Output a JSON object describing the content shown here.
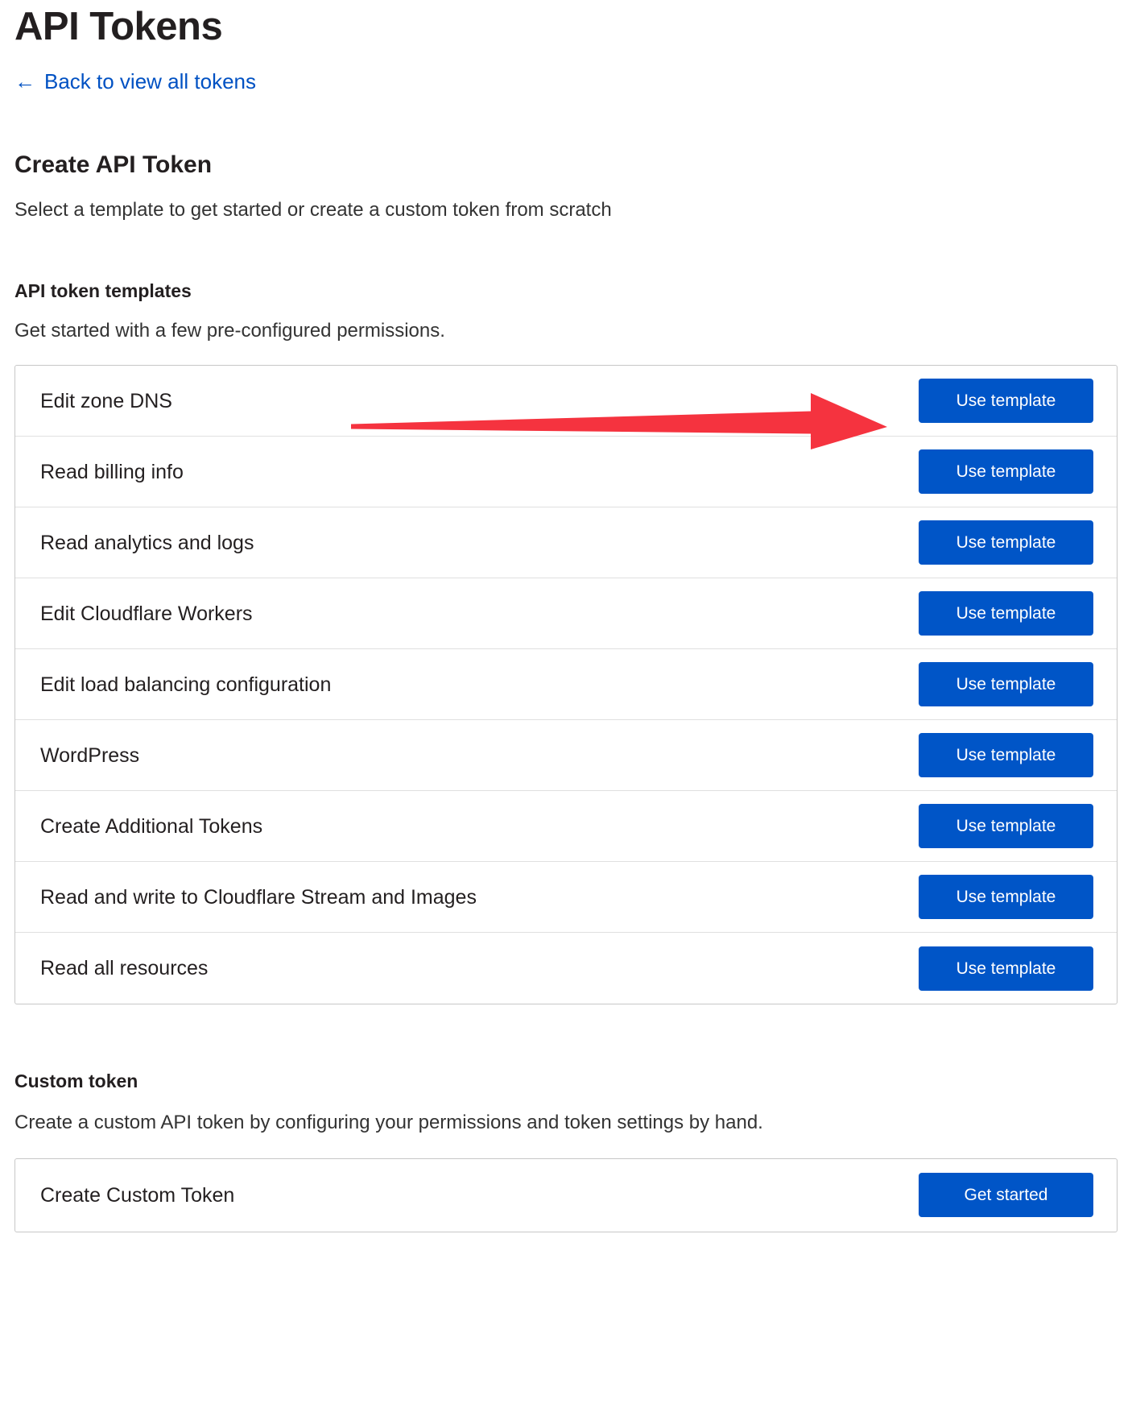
{
  "header": {
    "title": "API Tokens",
    "back_link": "Back to view all tokens",
    "back_arrow_icon": "left-arrow-icon"
  },
  "create_section": {
    "heading": "Create API Token",
    "description": "Select a template to get started or create a custom token from scratch"
  },
  "templates_section": {
    "heading": "API token templates",
    "description": "Get started with a few pre-configured permissions.",
    "button_label": "Use template",
    "rows": [
      {
        "label": "Edit zone DNS"
      },
      {
        "label": "Read billing info"
      },
      {
        "label": "Read analytics and logs"
      },
      {
        "label": "Edit Cloudflare Workers"
      },
      {
        "label": "Edit load balancing configuration"
      },
      {
        "label": "WordPress"
      },
      {
        "label": "Create Additional Tokens"
      },
      {
        "label": "Read and write to Cloudflare Stream and Images"
      },
      {
        "label": "Read all resources"
      }
    ]
  },
  "custom_section": {
    "heading": "Custom token",
    "description": "Create a custom API token by configuring your permissions and token settings by hand.",
    "row_label": "Create Custom Token",
    "button_label": "Get started"
  },
  "annotation": {
    "arrow_icon": "right-arrow-annotation-icon",
    "arrow_color": "#f5333f",
    "points_at": "Edit zone DNS - Use template"
  },
  "colors": {
    "primary_button": "#0055c7",
    "link": "#0051c3",
    "text": "#231f20",
    "border": "#c7c7c7",
    "row_divider": "#e0e0e0",
    "annotation_red": "#f5333f"
  }
}
